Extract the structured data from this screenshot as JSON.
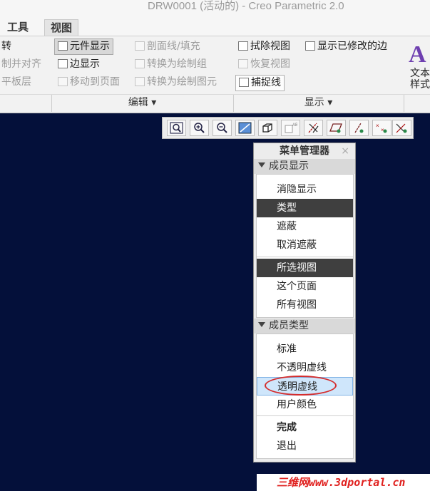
{
  "window": {
    "title": "DRW0001 (活动的) - Creo Parametric 2.0"
  },
  "tabs": [
    {
      "label": "工具"
    },
    {
      "label": "视图"
    }
  ],
  "ribbon": {
    "col1": [
      "转",
      "制并对齐",
      "平板层"
    ],
    "col2": [
      "元件显示",
      "边显示",
      "移动到页面"
    ],
    "col3": [
      "剖面线/填充",
      "转换为绘制组",
      "转换为绘制图元"
    ],
    "col4": [
      "拭除视图",
      "恢复视图",
      "捕捉线"
    ],
    "col5": [
      "显示已修改的边"
    ],
    "text_style": {
      "line1": "文本",
      "line2": "样式"
    },
    "groups": {
      "edit": "编辑 ▾",
      "display": "显示 ▾"
    }
  },
  "toolbar": {
    "icons": [
      "zoom-fit-icon",
      "zoom-in-icon",
      "zoom-out-icon",
      "repaint-icon",
      "display-style-icon",
      "saved-views-icon",
      "datum-axis-icon",
      "datum-plane-icon",
      "datum-point-icon",
      "coordinate-system-icon",
      "annotation-display-icon"
    ]
  },
  "menu_manager": {
    "title": "菜单管理器",
    "close": "×",
    "section1": {
      "label": "成员显示",
      "items": [
        "消隐显示",
        "类型",
        "遮蔽",
        "取消遮蔽"
      ],
      "items2": [
        "所选视图",
        "这个页面",
        "所有视图"
      ]
    },
    "section2": {
      "label": "成员类型",
      "items": [
        "标准",
        "不透明虚线",
        "透明虚线",
        "用户颜色"
      ],
      "items2": [
        "完成",
        "退出"
      ]
    }
  },
  "watermark": {
    "text": "三维网www.3dportal.cn"
  },
  "colors": {
    "canvas": "#04103a",
    "selected": "#3f3f3f",
    "highlight": "#cfe6fb",
    "circle": "#d42c2c"
  }
}
